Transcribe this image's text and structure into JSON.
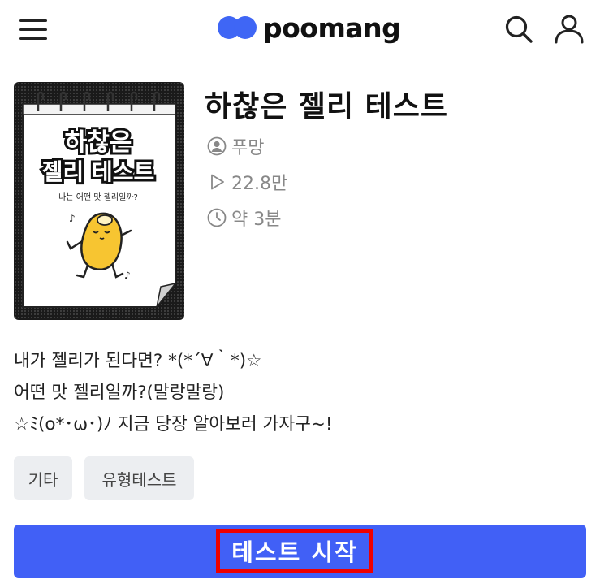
{
  "header": {
    "logo_text": "poomang",
    "brand_color": "#3f66f5",
    "icons": [
      "menu-icon",
      "search-icon",
      "user-icon"
    ]
  },
  "test": {
    "title": "하찮은 젤리 테스트",
    "author": "푸망",
    "views": "22.8만",
    "duration": "약 3분",
    "cover": {
      "title_line1": "하찮은",
      "title_line2": "젤리 테스트",
      "subtitle": "나는 어떤 맛 젤리일까?"
    },
    "description": [
      "내가 젤리가 된다면? *(*´∀｀*)☆",
      "어떤 맛 젤리일까?(말랑말랑)",
      "☆ﾐ(o*･ω･)ﾉ 지금 당장 알아보러 가자구~!"
    ],
    "tags": [
      "기타",
      "유형테스트"
    ]
  },
  "start_button": {
    "label": "테스트 시작",
    "color": "#4160f6"
  }
}
